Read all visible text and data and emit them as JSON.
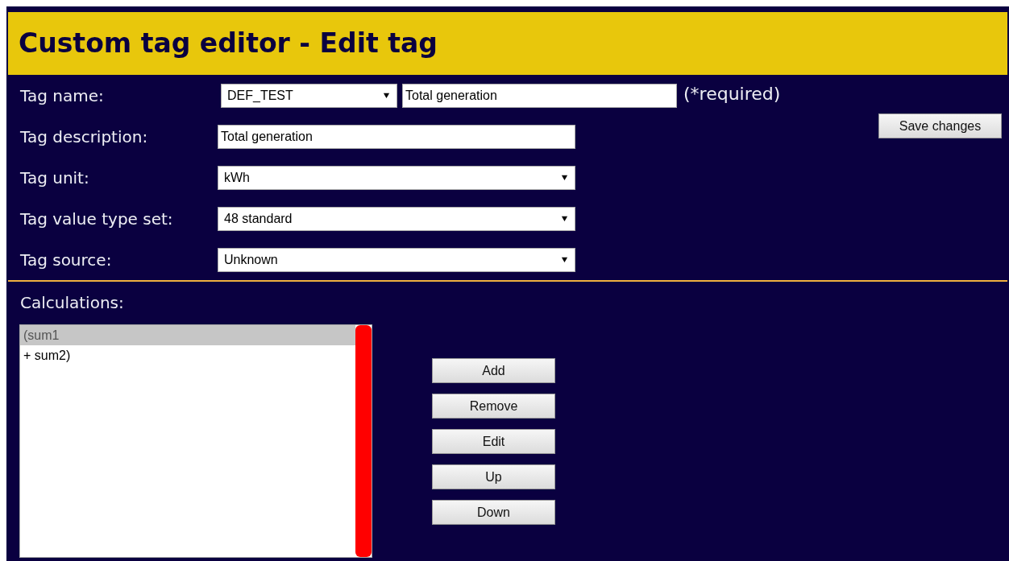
{
  "title": "Custom tag editor - Edit tag",
  "fields": [
    {
      "kind": "name",
      "label": "Tag name:",
      "select": "DEF_TEST",
      "value": "Total generation",
      "note": "(*required)"
    },
    {
      "kind": "text",
      "label": "Tag description:",
      "value": "Total generation"
    },
    {
      "kind": "select",
      "label": "Tag unit:",
      "value": "kWh"
    },
    {
      "kind": "select",
      "label": "Tag value type set:",
      "value": "48 standard"
    },
    {
      "kind": "select",
      "label": "Tag source:",
      "value": "Unknown"
    }
  ],
  "save_button": "Save changes",
  "calculations": {
    "label": "Calculations:",
    "items": [
      {
        "text": "(sum1",
        "selected": true
      },
      {
        "text": "+ sum2)",
        "selected": false
      }
    ],
    "buttons": [
      "Add",
      "Remove",
      "Edit",
      "Up",
      "Down"
    ]
  }
}
